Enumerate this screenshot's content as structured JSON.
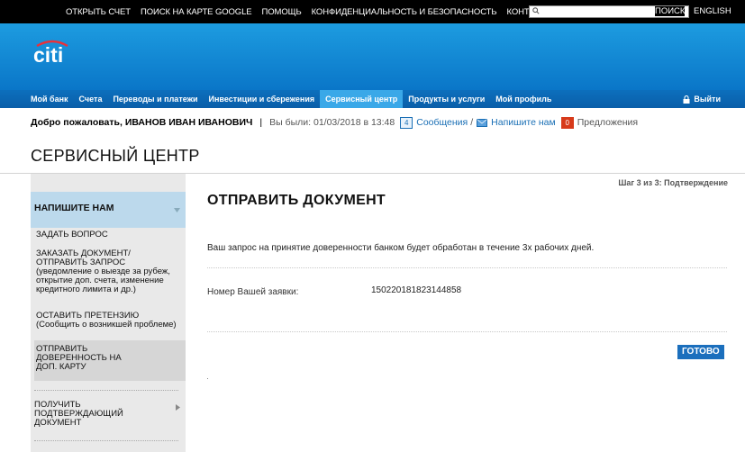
{
  "top_links": [
    "ОТКРЫТЬ СЧЕТ",
    "ПОИСК НА КАРТЕ GOOGLE",
    "ПОМОЩЬ",
    "КОНФИДЕНЦИАЛЬНОСТЬ И БЕЗОПАСНОСТЬ",
    "КОНТАКТЫ"
  ],
  "search": {
    "value": "",
    "button": "ПОИСК"
  },
  "language": "ENGLISH",
  "logo": "citi",
  "nav": {
    "items": [
      "Мой банк",
      "Счета",
      "Переводы и платежи",
      "Инвестиции и сбережения",
      "Сервисный центр",
      "Продукты и услуги",
      "Мой профиль"
    ],
    "active_index": 4,
    "logout": "Выйти"
  },
  "welcome": {
    "greeting": "Добро пожаловать, ИВАНОВ ИВАН ИВАНОВИЧ",
    "separator": "|",
    "last_visit": "Вы были: 01/03/2018 в 13:48",
    "messages_count": "4",
    "messages": "Сообщения",
    "slash": "/",
    "write_us": "Напишите нам",
    "offers_count": "0",
    "offers": "Предложения"
  },
  "page_title": "СЕРВИСНЫЙ ЦЕНТР",
  "sidebar": {
    "section": "НАПИШИТЕ НАМ",
    "items": [
      {
        "title": "ЗАДАТЬ ВОПРОС",
        "sub": ""
      },
      {
        "title": "ЗАКАЗАТЬ ДОКУМЕНТ/ ОТПРАВИТЬ ЗАПРОС",
        "sub": "(уведомление о выезде за рубеж, открытие доп. счета, изменение кредитного лимита и др.)"
      },
      {
        "title": "ОСТАВИТЬ ПРЕТЕНЗИЮ",
        "sub": "(Сообщить о возникшей проблеме)"
      },
      {
        "title": "ОТПРАВИТЬ ДОВЕРЕННОСТЬ НА ДОП. КАРТУ",
        "sub": ""
      }
    ],
    "other_section": "ПОЛУЧИТЬ ПОДТВЕРЖДАЮЩИЙ ДОКУМЕНТ"
  },
  "main": {
    "step": "Шаг 3 из 3: Подтверждение",
    "title": "ОТПРАВИТЬ ДОКУМЕНТ",
    "message": "Ваш запрос на принятие доверенности банком будет обработан в течение 3х рабочих дней.",
    "order_label": "Номер Вашей заявки:",
    "order_number": "150220181823144858",
    "done_button": "ГОТОВО"
  },
  "colors": {
    "header": "#1d9ce0",
    "nav": "#0a5ea9",
    "nav_active": "#3aa8e8",
    "sidebar_head": "#bcd9ec",
    "button": "#1b6fbd"
  }
}
